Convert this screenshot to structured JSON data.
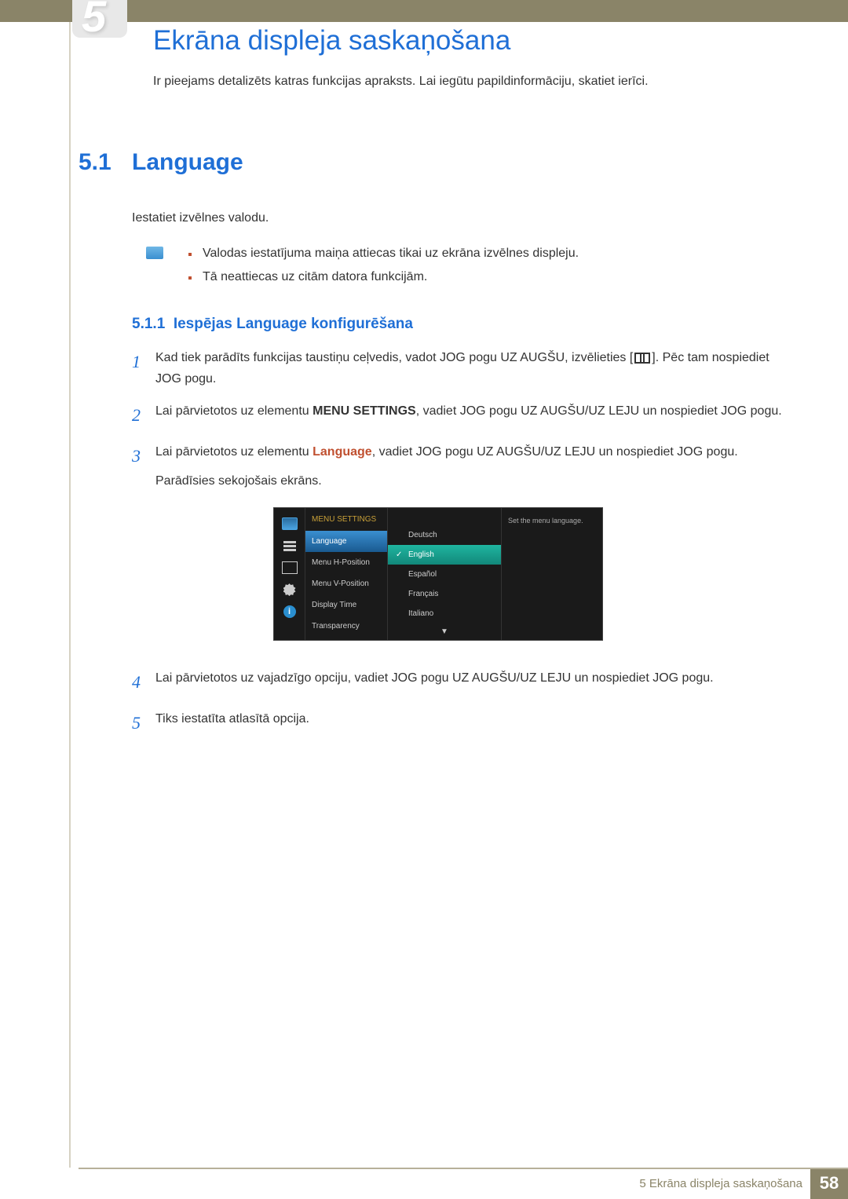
{
  "header": {
    "chapter_number": "5",
    "page_title": "Ekrāna displeja saskaņošana",
    "intro": "Ir pieejams detalizēts katras funkcijas apraksts. Lai iegūtu papildinformāciju, skatiet ierīci."
  },
  "section": {
    "number": "5.1",
    "title": "Language",
    "body": "Iestatiet izvēlnes valodu.",
    "notes": [
      "Valodas iestatījuma maiņa attiecas tikai uz ekrāna izvēlnes displeju.",
      "Tā neattiecas uz citām datora funkcijām."
    ]
  },
  "subsection": {
    "number": "5.1.1",
    "title": "Iespējas Language konfigurēšana",
    "steps": [
      {
        "num": "1",
        "pre": "Kad tiek parādīts funkcijas taustiņu ceļvedis, vadot JOG pogu UZ AUGŠU, izvēlieties [",
        "post": "]. Pēc tam nospiediet JOG pogu."
      },
      {
        "num": "2",
        "pre": "Lai pārvietotos uz elementu ",
        "bold": "MENU SETTINGS",
        "post": ", vadiet JOG pogu UZ AUGŠU/UZ LEJU un nospiediet JOG pogu."
      },
      {
        "num": "3",
        "pre": "Lai pārvietotos uz elementu ",
        "red": "Language",
        "post": ", vadiet JOG pogu UZ AUGŠU/UZ LEJU un nospiediet JOG pogu.",
        "after": "Parādīsies sekojošais ekrāns."
      },
      {
        "num": "4",
        "text": "Lai pārvietotos uz vajadzīgo opciju, vadiet JOG pogu UZ AUGŠU/UZ LEJU un nospiediet JOG pogu."
      },
      {
        "num": "5",
        "text": "Tiks iestatīta atlasītā opcija."
      }
    ]
  },
  "osd": {
    "header": "MENU SETTINGS",
    "items": [
      "Language",
      "Menu H-Position",
      "Menu V-Position",
      "Display Time",
      "Transparency"
    ],
    "options": [
      "Deutsch",
      "English",
      "Español",
      "Français",
      "Italiano"
    ],
    "selected_item_index": 0,
    "selected_option_index": 1,
    "help": "Set the menu language."
  },
  "footer": {
    "text": "5 Ekrāna displeja saskaņošana",
    "page": "58"
  }
}
